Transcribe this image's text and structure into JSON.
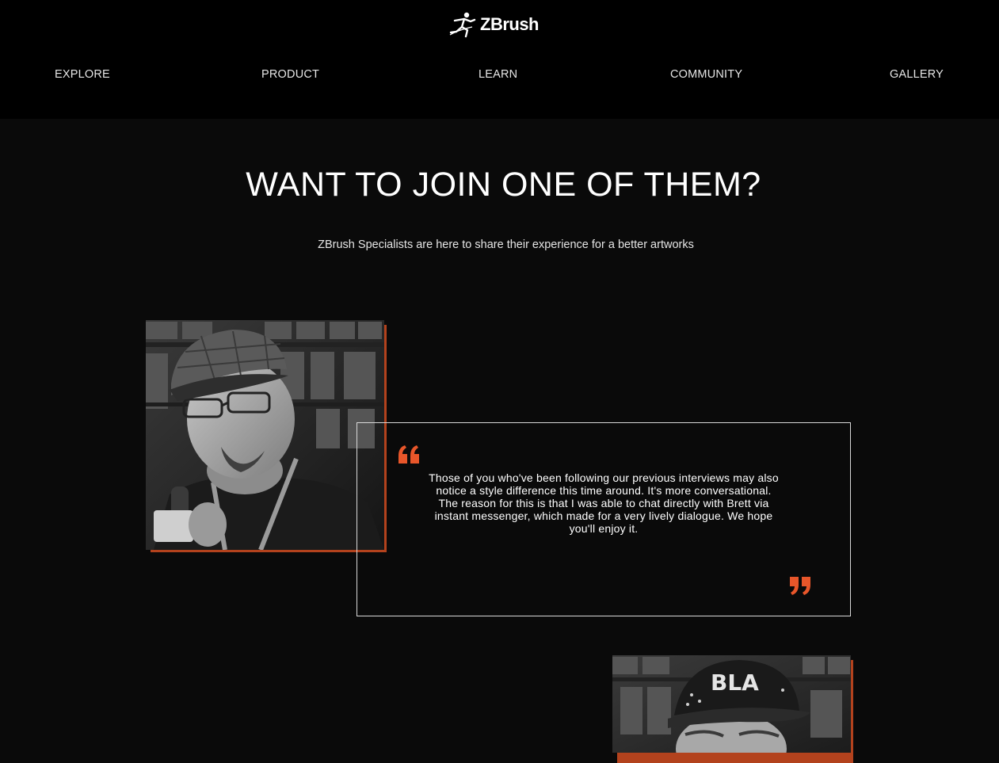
{
  "header": {
    "logo_text": "ZBrush",
    "logo_icon": "zbrush-runner-icon",
    "nav": [
      {
        "label": "EXPLORE"
      },
      {
        "label": "PRODUCT"
      },
      {
        "label": "LEARN"
      },
      {
        "label": "COMMUNITY"
      },
      {
        "label": "GALLERY"
      }
    ]
  },
  "hero": {
    "title": "WANT TO JOIN ONE OF THEM?",
    "subtitle": "ZBrush Specialists are here to share their experience for a better artworks"
  },
  "specialists": [
    {
      "photo": "portrait-man-plaid-cap-glasses",
      "quote": "Those of you who've been following our previous interviews may also notice a style difference this time around. It's more conversational. The reason for this is that I was able to chat directly with Brett via instant messenger, which made for a very lively dialogue. We hope you'll enjoy it."
    },
    {
      "photo": "portrait-man-baseball-cap"
    }
  ],
  "colors": {
    "background": "#0a0a0a",
    "header_background": "#000000",
    "accent": "#e8562a",
    "photo_shadow": "#b3421d",
    "border": "#d9d9d9"
  }
}
